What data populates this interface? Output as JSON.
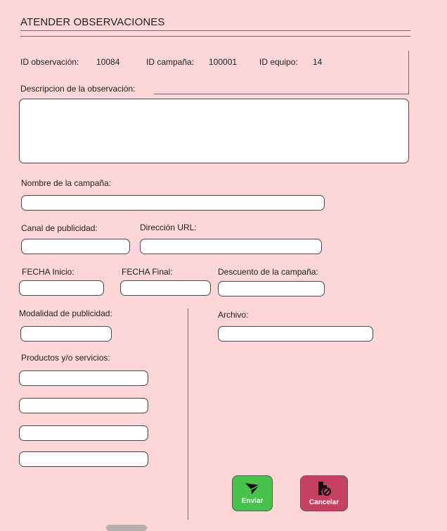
{
  "form": {
    "title": "ATENDER OBSERVACIONES"
  },
  "ids": {
    "observacion_label": "ID observación:",
    "observacion_value": "10084",
    "campana_label": "ID campaña:",
    "campana_value": "100001",
    "equipo_label": "ID equipo:",
    "equipo_value": "14"
  },
  "fields": {
    "descripcion_label": "Descripcion de la observación:",
    "descripcion_value": "",
    "nombre_label": "Nombre de la campaña:",
    "canal_label": "Canal de publicidad:",
    "url_label": "Dirección URL:",
    "fecha_inicio_label": "FECHA Inicio:",
    "fecha_final_label": "FECHA Final:",
    "descuento_label": "Descuento de la campaña:",
    "modalidad_label": "Modalidad de publicidad:",
    "archivo_label": "Archivo:",
    "productos_label": "Productos y/o servicios:"
  },
  "buttons": {
    "enviar": "Enviar",
    "cancelar": "Cancelar"
  },
  "colors": {
    "background": "#fdd7d7",
    "enviar": "#48c24b",
    "cancelar": "#c44260"
  },
  "icons": {
    "enviar": "send-icon",
    "cancelar": "file-cancel-icon"
  }
}
